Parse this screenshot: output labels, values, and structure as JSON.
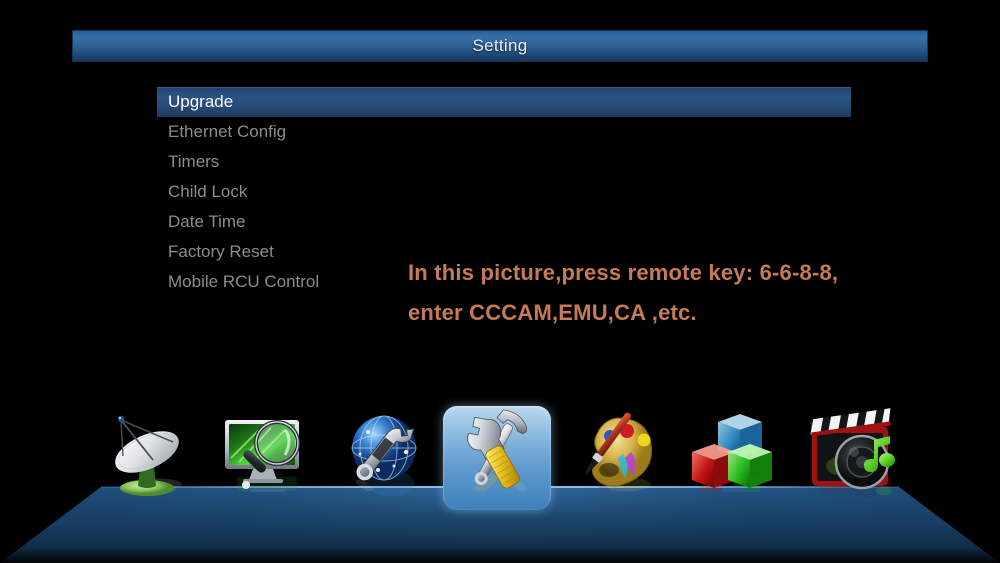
{
  "window": {
    "title": "Setting"
  },
  "menu": {
    "items": [
      {
        "label": "Upgrade",
        "selected": true
      },
      {
        "label": "Ethernet Config",
        "selected": false
      },
      {
        "label": "Timers",
        "selected": false
      },
      {
        "label": "Child Lock",
        "selected": false
      },
      {
        "label": "Date Time",
        "selected": false
      },
      {
        "label": "Factory Reset",
        "selected": false
      },
      {
        "label": "Mobile RCU Control",
        "selected": false
      }
    ]
  },
  "annotation": {
    "line1": "In this picture,press remote key: 6-6-8-8,",
    "line2": "enter CCCAM,EMU,CA ,etc.",
    "color": "#c67a57"
  },
  "dock": {
    "items": [
      {
        "name": "satellite-dish-icon",
        "label": "Installation",
        "selected": false
      },
      {
        "name": "tv-search-icon",
        "label": "Channel Search",
        "selected": false
      },
      {
        "name": "network-globe-wrench-icon",
        "label": "Network",
        "selected": false
      },
      {
        "name": "tools-icon",
        "label": "Setting",
        "selected": true
      },
      {
        "name": "paint-palette-icon",
        "label": "Appearance",
        "selected": false
      },
      {
        "name": "blocks-icon",
        "label": "Applications",
        "selected": false
      },
      {
        "name": "media-player-icon",
        "label": "Media",
        "selected": false
      }
    ]
  },
  "theme": {
    "background": "#000000",
    "titlebar_accent": "#3670a8",
    "floor_blue": "#1f4f7e",
    "menu_text": "#8c8c8c",
    "menu_selected_text": "#ffffff"
  }
}
